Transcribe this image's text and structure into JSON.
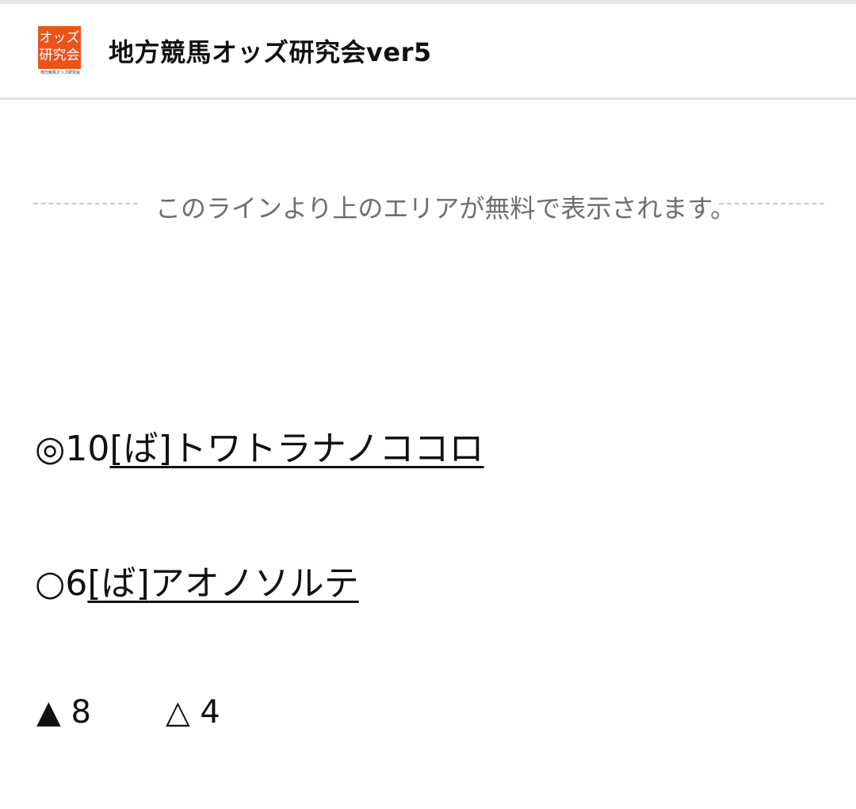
{
  "header": {
    "logo": {
      "box_text_line1": "オッズ",
      "box_text_line2": "研究会",
      "caption": "地方競馬オッズ研究会",
      "color": "#e8541c"
    },
    "title": "地方競馬オッズ研究会ver5"
  },
  "paywall": {
    "text": "このラインより上のエリアが無料で表示されます。"
  },
  "picks": [
    {
      "symbol": "◎",
      "number": "10",
      "tag": "[ば]",
      "name": "トワトラナノココロ"
    },
    {
      "symbol": "○",
      "number": "6",
      "tag": "[ば]",
      "name": "アオノソルテ"
    }
  ],
  "others": [
    {
      "symbol": "▲",
      "number": "8"
    },
    {
      "symbol": "△",
      "number": "4"
    }
  ]
}
